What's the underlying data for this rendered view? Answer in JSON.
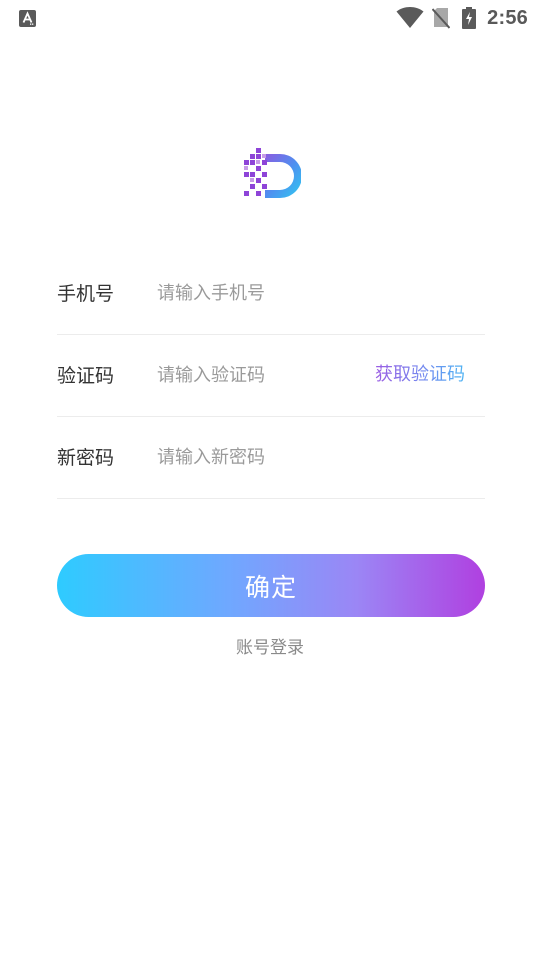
{
  "status_bar": {
    "left_icon": "accessibility-a-icon",
    "icons": [
      "wifi-icon",
      "no-sim-icon",
      "battery-charging-icon"
    ],
    "time": "2:56"
  },
  "logo": {
    "icon": "pixel-d-logo-icon"
  },
  "form": {
    "phone": {
      "label": "手机号",
      "placeholder": "请输入手机号",
      "value": ""
    },
    "code": {
      "label": "验证码",
      "placeholder": "请输入验证码",
      "value": "",
      "get_code_label": "获取验证码"
    },
    "password": {
      "label": "新密码",
      "placeholder": "请输入新密码",
      "value": ""
    }
  },
  "confirm_label": "确定",
  "account_login_label": "账号登录",
  "colors": {
    "button_gradient_start": "#2ecbff",
    "button_gradient_end": "#b040e0",
    "get_code_start": "#9b5ce3",
    "get_code_end": "#4fb4f3"
  }
}
